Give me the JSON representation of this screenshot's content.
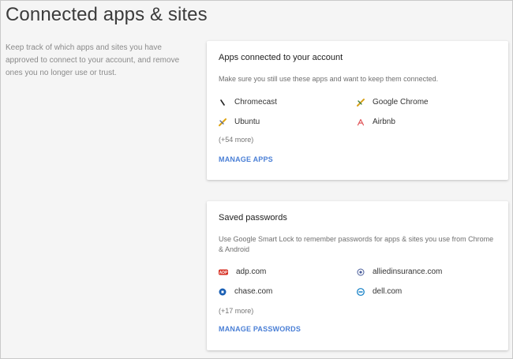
{
  "page": {
    "title": "Connected apps & sites",
    "intro": "Keep track of which apps and sites you have approved to connect to your account, and remove ones you no longer use or trust."
  },
  "apps_card": {
    "title": "Apps connected to your account",
    "description": "Make sure you still use these apps and want to keep them connected.",
    "items": [
      {
        "label": "Chromecast",
        "icon": "chromecast-icon"
      },
      {
        "label": "Google Chrome",
        "icon": "google-chrome-icon"
      },
      {
        "label": "Ubuntu",
        "icon": "ubuntu-icon"
      },
      {
        "label": "Airbnb",
        "icon": "airbnb-icon"
      }
    ],
    "more": "(+54 more)",
    "action": "MANAGE APPS"
  },
  "passwords_card": {
    "title": "Saved passwords",
    "description": "Use Google Smart Lock to remember passwords for apps & sites you use from Chrome & Android",
    "items": [
      {
        "label": "adp.com",
        "icon": "adp-icon"
      },
      {
        "label": "alliedinsurance.com",
        "icon": "allied-insurance-icon"
      },
      {
        "label": "chase.com",
        "icon": "chase-icon"
      },
      {
        "label": "dell.com",
        "icon": "dell-icon"
      }
    ],
    "more": "(+17 more)",
    "action": "MANAGE PASSWORDS"
  },
  "colors": {
    "accent": "#4a7fd6",
    "background": "#f5f5f5",
    "card": "#ffffff"
  }
}
